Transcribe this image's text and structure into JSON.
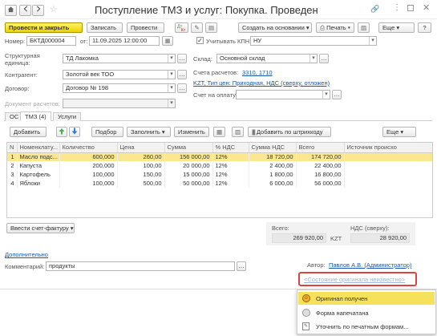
{
  "window": {
    "title": "Поступление ТМЗ и услуг: Покупка. Проведен",
    "home_icon": "home-icon",
    "back_icon": "arrow-left-icon",
    "forward_icon": "arrow-right-icon",
    "star_icon": "star-icon"
  },
  "toolbar": {
    "post_close": "Провести и закрыть",
    "save": "Записать",
    "post": "Провести",
    "create_basis": "Создать на основании",
    "print": "Печать",
    "more": "Еще",
    "help": "?"
  },
  "header": {
    "number_label": "Номер:",
    "number_value": "БКТД000004",
    "date_label": "от:",
    "date_value": "11.09.2025 12:00:00",
    "kpn_label": "Учитывать КПН",
    "kpn_value": "НУ",
    "unit_label": "Структурная единица:",
    "unit_value": "ТД Лакомка",
    "warehouse_label": "Склад:",
    "warehouse_value": "Основной склад",
    "counterparty_label": "Контрагент:",
    "counterparty_value": "Золотой век ТОО",
    "accounts_label": "Счета расчетов:",
    "accounts_value": "3310, 1710",
    "price_type_link": "KZT, Тип цен: Приходная, НДС (сверху, отложен)",
    "contract_label": "Договор:",
    "contract_value": "Договор № 198",
    "payment_label": "Счет на оплату:",
    "payment_value": "",
    "calc_doc_label": "Документ расчетов:",
    "calc_doc_value": ""
  },
  "tabs": [
    {
      "label": "ОС"
    },
    {
      "label": "ТМЗ (4)"
    },
    {
      "label": "Услуги"
    }
  ],
  "table_toolbar": {
    "add": "Добавить",
    "selection": "Подбор",
    "fill": "Заполнить",
    "change": "Изменить",
    "add_barcode": "Добавить по штрихкоду",
    "more": "Еще"
  },
  "columns": [
    "N",
    "Номенклату...",
    "Количество",
    "Цена",
    "Сумма",
    "% НДС",
    "Сумма НДС",
    "Всего",
    "Источник происхо"
  ],
  "rows": [
    {
      "n": "1",
      "name": "Масло подс...",
      "qty": "600,000",
      "price": "260,00",
      "sum": "156 000,00",
      "vat_rate": "12%",
      "vat_sum": "18 720,00",
      "total": "174 720,00",
      "source": ""
    },
    {
      "n": "2",
      "name": "Капуста",
      "qty": "200,000",
      "price": "100,00",
      "sum": "20 000,00",
      "vat_rate": "12%",
      "vat_sum": "2 400,00",
      "total": "22 400,00",
      "source": ""
    },
    {
      "n": "3",
      "name": "Картофель",
      "qty": "100,000",
      "price": "150,00",
      "sum": "15 000,00",
      "vat_rate": "12%",
      "vat_sum": "1 800,00",
      "total": "16 800,00",
      "source": ""
    },
    {
      "n": "4",
      "name": "Яблоки",
      "qty": "100,000",
      "price": "500,00",
      "sum": "50 000,00",
      "vat_rate": "12%",
      "vat_sum": "6 000,00",
      "total": "56 000,00",
      "source": ""
    }
  ],
  "footer": {
    "invoice_button": "Ввести счет-фактуру",
    "total_label": "Всего:",
    "total_value": "269 920,00",
    "currency": "KZT",
    "vat_label": "НДС (сверху):",
    "vat_value": "28 920,00",
    "additional_link": "Дополнительно",
    "comment_label": "Комментарий:",
    "comment_value": "продукты",
    "author_label": "Автор:",
    "author_value": "Павлов А.В. (Администратор)",
    "original_state_link": "<Состояние оригинала неизвестно>"
  },
  "dropdown": {
    "items": [
      {
        "label": "Оригинал получен",
        "icon": "original-received-icon"
      },
      {
        "label": "Форма напечатана",
        "icon": "printed-form-icon"
      },
      {
        "label": "Уточнить по печатным формам...",
        "icon": "clarify-forms-icon"
      }
    ]
  },
  "colors": {
    "accent_yellow": "#f6e15a",
    "link_blue": "#1a5aa6",
    "highlight_red": "#e04040",
    "selected_row": "#fbe790",
    "green_arrow": "#4caf50",
    "blue_arrow": "#2a7fd4"
  }
}
